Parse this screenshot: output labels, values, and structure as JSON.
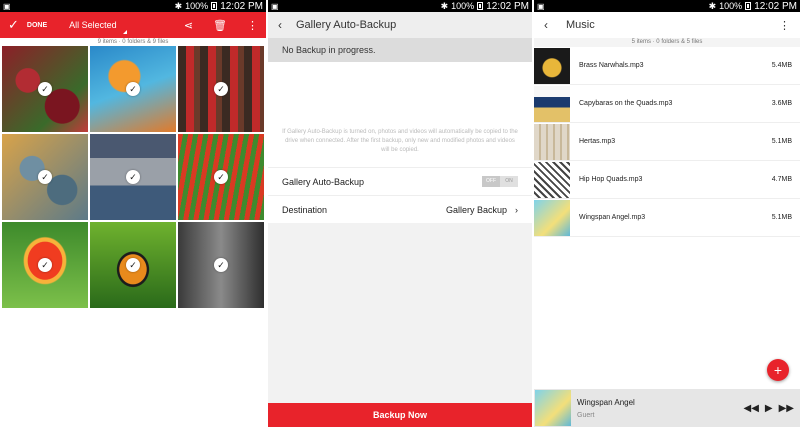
{
  "status_bar": {
    "signal_text": "100%",
    "time": "12:02 PM"
  },
  "gallery": {
    "done_label": "DONE",
    "selection_label": "All Selected",
    "info": "9 items · 0 folders & 9 files",
    "photos": [
      "roses",
      "jellyfish",
      "guitars",
      "succulents",
      "palace",
      "tulip-field",
      "red-tulip",
      "butterfly",
      "old-room"
    ],
    "check_glyph": "✓"
  },
  "backup": {
    "title": "Gallery Auto-Backup",
    "notice": "No Backup in progress.",
    "description": "If Gallery Auto-Backup is turned on, photos and videos will automatically be copied to the drive when connected. After the first backup, only new and modified photos and videos will be copied.",
    "auto_backup_label": "Gallery Auto-Backup",
    "toggle_off": "OFF",
    "toggle_on": "ON",
    "destination_label": "Destination",
    "destination_value": "Gallery Backup",
    "button_label": "Backup Now"
  },
  "music": {
    "title": "Music",
    "info": "5 items · 0 folders & 5 files",
    "songs": [
      {
        "title": "Brass Narwhals.mp3",
        "size": "5.4MB"
      },
      {
        "title": "Capybaras on the Quads.mp3",
        "size": "3.6MB"
      },
      {
        "title": "Hertas.mp3",
        "size": "5.1MB"
      },
      {
        "title": "Hip Hop Quads.mp3",
        "size": "4.7MB"
      },
      {
        "title": "Wingspan Angel.mp3",
        "size": "5.1MB"
      }
    ],
    "now_playing": {
      "title": "Wingspan Angel",
      "artist": "Guert"
    }
  },
  "colors": {
    "accent": "#e8232b"
  }
}
